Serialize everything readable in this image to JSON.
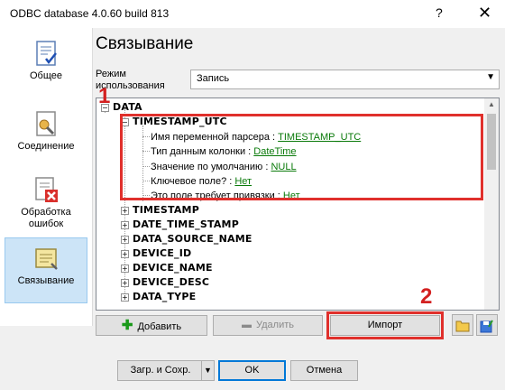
{
  "window": {
    "title": "ODBC database 4.0.60 build 813",
    "help_glyph": "?",
    "close_glyph": "✕"
  },
  "nav": {
    "items": [
      {
        "label": "Общее"
      },
      {
        "label": "Соединение"
      },
      {
        "label": "Обработка ошибок"
      },
      {
        "label": "Связывание"
      }
    ]
  },
  "page": {
    "title": "Связывание",
    "mode_label": "Режим использования",
    "mode_value": "Запись"
  },
  "tree": {
    "root": "DATA",
    "expanded": {
      "name": "TIMESTAMP_UTC",
      "props": [
        {
          "label": "Имя переменной парсера : ",
          "value": "TIMESTAMP_UTC"
        },
        {
          "label": "Тип данным колонки : ",
          "value": "DateTime"
        },
        {
          "label": "Значение по умолчанию : ",
          "value": "NULL"
        },
        {
          "label": "Ключевое поле? : ",
          "value": "Нет"
        },
        {
          "label": "Это поле требует привязки : ",
          "value": "Нет"
        }
      ]
    },
    "fields": [
      "TIMESTAMP",
      "DATE_TIME_STAMP",
      "DATA_SOURCE_NAME",
      "DEVICE_ID",
      "DEVICE_NAME",
      "DEVICE_DESC",
      "DATA_TYPE"
    ]
  },
  "annotations": {
    "one": "1",
    "two": "2",
    "color": "#e0302c"
  },
  "actions": {
    "add": "Добавить",
    "delete": "Удалить",
    "import": "Импорт"
  },
  "footer": {
    "load_save": "Загр. и Сохр.",
    "ok": "OK",
    "cancel": "Отмена"
  }
}
